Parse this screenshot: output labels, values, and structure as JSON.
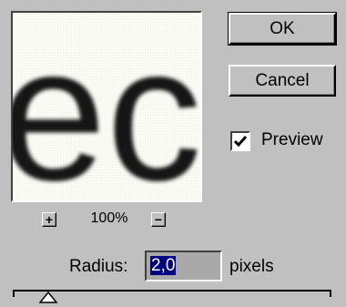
{
  "dialog": {
    "buttons": {
      "ok_label": "OK",
      "cancel_label": "Cancel"
    },
    "preview": {
      "label": "Preview",
      "checked": true,
      "zoom_level": "100%",
      "zoom_in_symbol": "+",
      "zoom_out_symbol": "−",
      "sample_text": "ec"
    },
    "radius": {
      "label": "Radius:",
      "value": "2,0",
      "units": "pixels"
    }
  },
  "colors": {
    "dialog_bg": "#c0c0c0",
    "selection_bg": "#000080",
    "input_bg": "#a9a9a9"
  },
  "icons": {
    "zoom_in": "plus-icon",
    "zoom_out": "minus-icon",
    "checkmark": "checkmark-icon",
    "slider_thumb": "triangle-icon"
  }
}
